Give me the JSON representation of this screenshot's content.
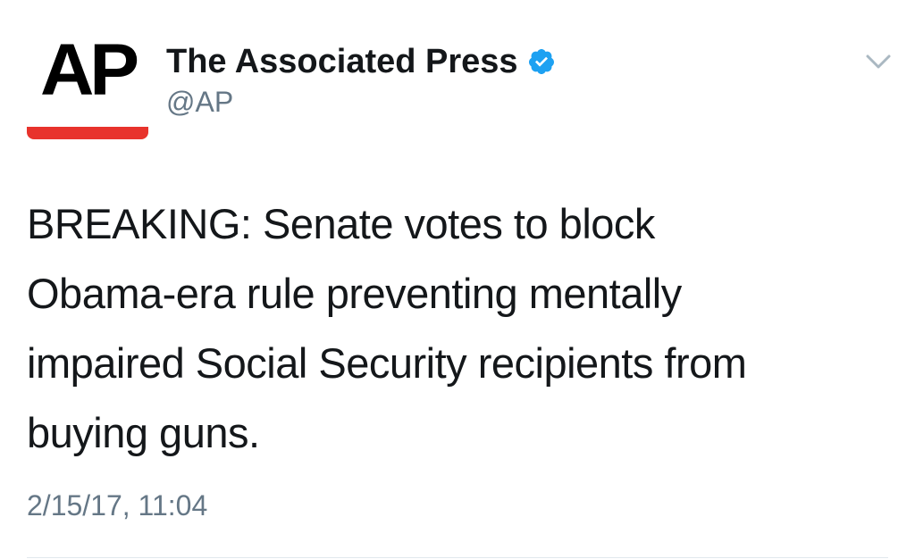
{
  "tweet": {
    "avatar": {
      "logo_text": "AP",
      "accent_color": "#e8332c"
    },
    "user": {
      "display_name": "The Associated Press",
      "handle": "@AP",
      "verified": true,
      "verified_color": "#1da1f2"
    },
    "menu_icon": "chevron-down-icon",
    "text": "BREAKING: Senate votes to block\nObama-era rule preventing mentally\nimpaired Social Security recipients from\nbuying guns.",
    "timestamp": "2/15/17, 11:04"
  }
}
